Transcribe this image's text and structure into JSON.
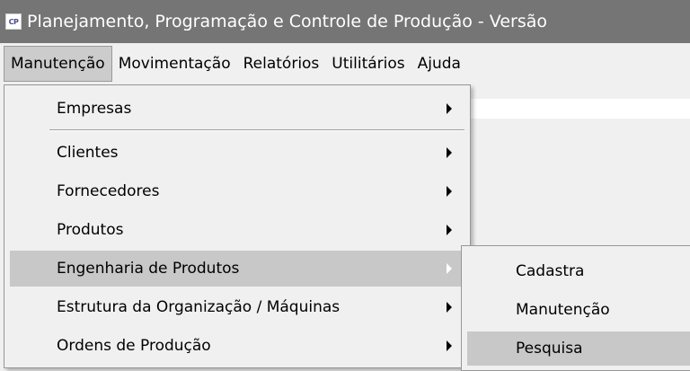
{
  "window": {
    "icon_text": "CP",
    "title": "Planejamento, Programação e Controle de Produção - Versão"
  },
  "menubar": {
    "items": [
      {
        "label": "Manutenção"
      },
      {
        "label": "Movimentação"
      },
      {
        "label": "Relatórios"
      },
      {
        "label": "Utilitários"
      },
      {
        "label": "Ajuda"
      }
    ]
  },
  "dropdown": {
    "items": [
      {
        "label": "Empresas",
        "has_submenu": true
      },
      {
        "label": "Clientes",
        "has_submenu": true
      },
      {
        "label": "Fornecedores",
        "has_submenu": true
      },
      {
        "label": "Produtos",
        "has_submenu": true
      },
      {
        "label": "Engenharia de Produtos",
        "has_submenu": true,
        "highlighted": true
      },
      {
        "label": "Estrutura da Organização / Máquinas",
        "has_submenu": true
      },
      {
        "label": "Ordens de Produção",
        "has_submenu": true
      }
    ]
  },
  "submenu": {
    "items": [
      {
        "label": "Cadastra"
      },
      {
        "label": "Manutenção"
      },
      {
        "label": "Pesquisa",
        "highlighted": true
      }
    ]
  },
  "colors": {
    "titlebar_bg": "#757575",
    "menu_bg": "#f0f0f0",
    "highlight_bg": "#c8c8c8"
  }
}
